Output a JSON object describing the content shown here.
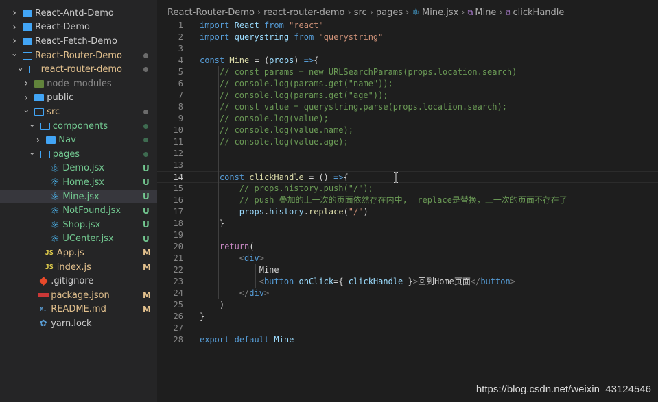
{
  "sidebar": {
    "items": [
      {
        "label": "React-Antd-Demo",
        "depth": 0,
        "kind": "folder",
        "open": false,
        "color": "#cccccc",
        "status": "",
        "status_color": ""
      },
      {
        "label": "React-Demo",
        "depth": 0,
        "kind": "folder",
        "open": false,
        "color": "#cccccc",
        "status": "",
        "status_color": ""
      },
      {
        "label": "React-Fetch-Demo",
        "depth": 0,
        "kind": "folder",
        "open": false,
        "color": "#cccccc",
        "status": "",
        "status_color": ""
      },
      {
        "label": "React-Router-Demo",
        "depth": 0,
        "kind": "folder",
        "open": true,
        "color": "#e2c08d",
        "status": "dot",
        "status_color": "#6b6b6b"
      },
      {
        "label": "react-router-demo",
        "depth": 1,
        "kind": "folder",
        "open": true,
        "color": "#e2c08d",
        "status": "dot",
        "status_color": "#6b6b6b"
      },
      {
        "label": "node_modules",
        "depth": 2,
        "kind": "node",
        "open": false,
        "color": "#8c8c8c",
        "status": "",
        "status_color": ""
      },
      {
        "label": "public",
        "depth": 2,
        "kind": "folder",
        "open": false,
        "color": "#cccccc",
        "status": "",
        "status_color": ""
      },
      {
        "label": "src",
        "depth": 2,
        "kind": "folder",
        "open": true,
        "color": "#e2c08d",
        "status": "dot",
        "status_color": "#6b6b6b"
      },
      {
        "label": "components",
        "depth": 3,
        "kind": "folder",
        "open": true,
        "color": "#73c991",
        "status": "dot",
        "status_color": "#3e6b50"
      },
      {
        "label": "Nav",
        "depth": 4,
        "kind": "folder",
        "open": false,
        "color": "#73c991",
        "status": "dot",
        "status_color": "#3e6b50"
      },
      {
        "label": "pages",
        "depth": 3,
        "kind": "folder",
        "open": true,
        "color": "#73c991",
        "status": "dot",
        "status_color": "#3e6b50"
      },
      {
        "label": "Demo.jsx",
        "depth": 4,
        "kind": "react",
        "open": false,
        "color": "#73c991",
        "status": "U",
        "status_color": "#73c991"
      },
      {
        "label": "Home.jsx",
        "depth": 4,
        "kind": "react",
        "open": false,
        "color": "#73c991",
        "status": "U",
        "status_color": "#73c991"
      },
      {
        "label": "Mine.jsx",
        "depth": 4,
        "kind": "react",
        "open": false,
        "color": "#73c991",
        "status": "U",
        "status_color": "#73c991",
        "selected": true
      },
      {
        "label": "NotFound.jsx",
        "depth": 4,
        "kind": "react",
        "open": false,
        "color": "#73c991",
        "status": "U",
        "status_color": "#73c991"
      },
      {
        "label": "Shop.jsx",
        "depth": 4,
        "kind": "react",
        "open": false,
        "color": "#73c991",
        "status": "U",
        "status_color": "#73c991"
      },
      {
        "label": "UCenter.jsx",
        "depth": 4,
        "kind": "react",
        "open": false,
        "color": "#73c991",
        "status": "U",
        "status_color": "#73c991"
      },
      {
        "label": "App.js",
        "depth": 3,
        "kind": "js",
        "open": false,
        "color": "#e2c08d",
        "status": "M",
        "status_color": "#e2c08d"
      },
      {
        "label": "index.js",
        "depth": 3,
        "kind": "js",
        "open": false,
        "color": "#e2c08d",
        "status": "M",
        "status_color": "#e2c08d"
      },
      {
        "label": ".gitignore",
        "depth": 2,
        "kind": "git",
        "open": false,
        "color": "#cccccc",
        "status": "",
        "status_color": ""
      },
      {
        "label": "package.json",
        "depth": 2,
        "kind": "npm",
        "open": false,
        "color": "#e2c08d",
        "status": "M",
        "status_color": "#e2c08d"
      },
      {
        "label": "README.md",
        "depth": 2,
        "kind": "md",
        "open": false,
        "color": "#e2c08d",
        "status": "M",
        "status_color": "#e2c08d"
      },
      {
        "label": "yarn.lock",
        "depth": 2,
        "kind": "yarn",
        "open": false,
        "color": "#cccccc",
        "status": "",
        "status_color": ""
      }
    ]
  },
  "breadcrumb": {
    "items": [
      {
        "label": "React-Router-Demo",
        "icon": ""
      },
      {
        "label": "react-router-demo",
        "icon": ""
      },
      {
        "label": "src",
        "icon": ""
      },
      {
        "label": "pages",
        "icon": ""
      },
      {
        "label": "Mine.jsx",
        "icon": "react-icon"
      },
      {
        "label": "Mine",
        "icon": "symbol-icon"
      },
      {
        "label": "clickHandle",
        "icon": "symbol-icon"
      }
    ]
  },
  "editor": {
    "current_line": 14,
    "lines": [
      {
        "n": "1",
        "t": [
          [
            "kw",
            "import"
          ],
          [
            "txt",
            " "
          ],
          [
            "var",
            "React"
          ],
          [
            "txt",
            " "
          ],
          [
            "kw",
            "from"
          ],
          [
            "txt",
            " "
          ],
          [
            "str",
            "\"react\""
          ]
        ]
      },
      {
        "n": "2",
        "t": [
          [
            "kw",
            "import"
          ],
          [
            "txt",
            " "
          ],
          [
            "var",
            "querystring"
          ],
          [
            "txt",
            " "
          ],
          [
            "kw",
            "from"
          ],
          [
            "txt",
            " "
          ],
          [
            "str",
            "\"querystring\""
          ]
        ]
      },
      {
        "n": "3",
        "t": []
      },
      {
        "n": "4",
        "t": [
          [
            "kw",
            "const"
          ],
          [
            "txt",
            " "
          ],
          [
            "fn",
            "Mine"
          ],
          [
            "txt",
            " = ("
          ],
          [
            "var",
            "props"
          ],
          [
            "txt",
            ") "
          ],
          [
            "kw",
            "=>"
          ],
          [
            "txt",
            "{"
          ]
        ]
      },
      {
        "n": "5",
        "t": [
          [
            "txt",
            "    "
          ],
          [
            "cm",
            "// const params = new URLSearchParams(props.location.search)"
          ]
        ]
      },
      {
        "n": "6",
        "t": [
          [
            "txt",
            "    "
          ],
          [
            "cm",
            "// console.log(params.get(\"name\"));"
          ]
        ]
      },
      {
        "n": "7",
        "t": [
          [
            "txt",
            "    "
          ],
          [
            "cm",
            "// console.log(params.get(\"age\"));"
          ]
        ]
      },
      {
        "n": "8",
        "t": [
          [
            "txt",
            "    "
          ],
          [
            "cm",
            "// const value = querystring.parse(props.location.search);"
          ]
        ]
      },
      {
        "n": "9",
        "t": [
          [
            "txt",
            "    "
          ],
          [
            "cm",
            "// console.log(value);"
          ]
        ]
      },
      {
        "n": "10",
        "t": [
          [
            "txt",
            "    "
          ],
          [
            "cm",
            "// console.log(value.name);"
          ]
        ]
      },
      {
        "n": "11",
        "t": [
          [
            "txt",
            "    "
          ],
          [
            "cm",
            "// console.log(value.age);"
          ]
        ]
      },
      {
        "n": "12",
        "t": []
      },
      {
        "n": "13",
        "t": []
      },
      {
        "n": "14",
        "t": [
          [
            "txt",
            "    "
          ],
          [
            "kw",
            "const"
          ],
          [
            "txt",
            " "
          ],
          [
            "fn",
            "clickHandle"
          ],
          [
            "txt",
            " = () "
          ],
          [
            "kw",
            "=>"
          ],
          [
            "txt",
            "{"
          ]
        ]
      },
      {
        "n": "15",
        "t": [
          [
            "txt",
            "        "
          ],
          [
            "cm",
            "// props.history.push(\"/\");"
          ]
        ]
      },
      {
        "n": "16",
        "t": [
          [
            "txt",
            "        "
          ],
          [
            "cm",
            "// push 叠加的上一次的页面依然存在内中,  replace是替换，上一次的页面不存在了"
          ]
        ]
      },
      {
        "n": "17",
        "t": [
          [
            "txt",
            "        "
          ],
          [
            "var",
            "props"
          ],
          [
            "txt",
            "."
          ],
          [
            "var",
            "history"
          ],
          [
            "txt",
            "."
          ],
          [
            "fn",
            "replace"
          ],
          [
            "txt",
            "("
          ],
          [
            "str",
            "\"/\""
          ],
          [
            "txt",
            ")"
          ]
        ]
      },
      {
        "n": "18",
        "t": [
          [
            "txt",
            "    }"
          ]
        ]
      },
      {
        "n": "19",
        "t": []
      },
      {
        "n": "20",
        "t": [
          [
            "txt",
            "    "
          ],
          [
            "ctl",
            "return"
          ],
          [
            "txt",
            "("
          ]
        ]
      },
      {
        "n": "21",
        "t": [
          [
            "txt",
            "        "
          ],
          [
            "pun",
            "<"
          ],
          [
            "tag",
            "div"
          ],
          [
            "pun",
            ">"
          ]
        ]
      },
      {
        "n": "22",
        "t": [
          [
            "txt",
            "            Mine"
          ]
        ]
      },
      {
        "n": "23",
        "t": [
          [
            "txt",
            "            "
          ],
          [
            "pun",
            "<"
          ],
          [
            "tag",
            "button"
          ],
          [
            "txt",
            " "
          ],
          [
            "var",
            "onClick"
          ],
          [
            "txt",
            "={ "
          ],
          [
            "var",
            "clickHandle"
          ],
          [
            "txt",
            " }"
          ],
          [
            "pun",
            ">"
          ],
          [
            "txt",
            "回到Home页面"
          ],
          [
            "pun",
            "</"
          ],
          [
            "tag",
            "button"
          ],
          [
            "pun",
            ">"
          ]
        ]
      },
      {
        "n": "24",
        "t": [
          [
            "txt",
            "        "
          ],
          [
            "pun",
            "</"
          ],
          [
            "tag",
            "div"
          ],
          [
            "pun",
            ">"
          ]
        ]
      },
      {
        "n": "25",
        "t": [
          [
            "txt",
            "    )"
          ]
        ]
      },
      {
        "n": "26",
        "t": [
          [
            "txt",
            "}"
          ]
        ]
      },
      {
        "n": "27",
        "t": []
      },
      {
        "n": "28",
        "t": [
          [
            "kw",
            "export"
          ],
          [
            "txt",
            " "
          ],
          [
            "kw",
            "default"
          ],
          [
            "txt",
            " "
          ],
          [
            "var",
            "Mine"
          ]
        ]
      }
    ]
  },
  "watermark": "https://blog.csdn.net/weixin_43124546"
}
